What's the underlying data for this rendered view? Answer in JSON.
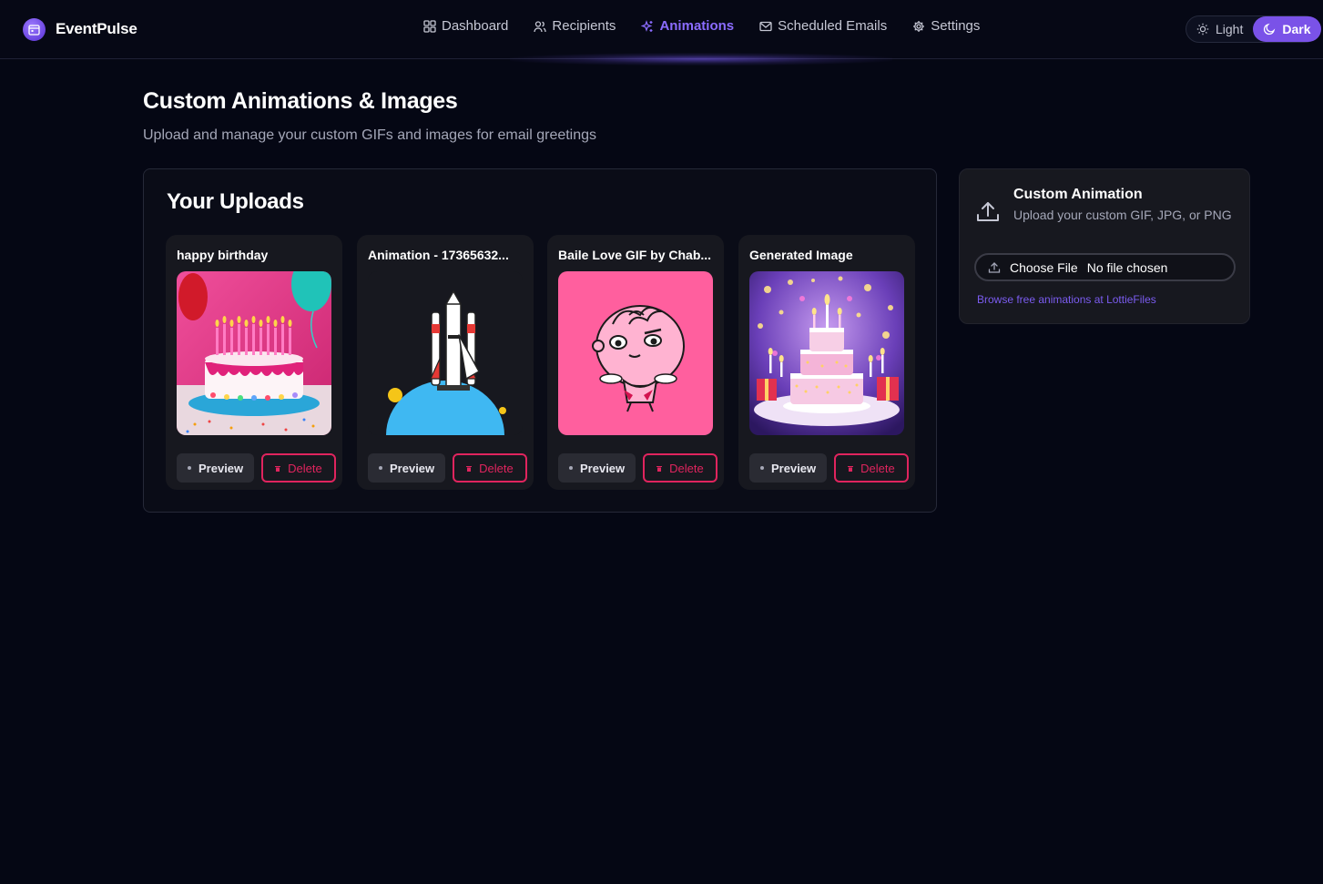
{
  "app": {
    "name": "EventPulse"
  },
  "nav": {
    "items": [
      {
        "label": "Dashboard",
        "icon": "grid-icon"
      },
      {
        "label": "Recipients",
        "icon": "users-icon"
      },
      {
        "label": "Animations",
        "icon": "sparkles-icon",
        "active": true
      },
      {
        "label": "Scheduled Emails",
        "icon": "mail-icon"
      },
      {
        "label": "Settings",
        "icon": "gear-icon"
      }
    ]
  },
  "theme": {
    "light_label": "Light",
    "dark_label": "Dark",
    "selected": "Dark"
  },
  "page": {
    "title": "Custom Animations & Images",
    "subtitle": "Upload and manage your custom GIFs and images for email greetings"
  },
  "uploads": {
    "title": "Your Uploads",
    "items": [
      {
        "title": "happy birthday",
        "thumbnail": "birthday-cake-photo"
      },
      {
        "title": "Animation - 17365632...",
        "thumbnail": "rocket-launch-illustration"
      },
      {
        "title": "Baile Love GIF by Chab...",
        "thumbnail": "pink-cartoon-character"
      },
      {
        "title": "Generated Image",
        "thumbnail": "tiered-cake-sparkles"
      }
    ],
    "preview_label": "Preview",
    "delete_label": "Delete"
  },
  "upload_panel": {
    "title": "Custom Animation",
    "description": "Upload your custom GIF, JPG, or PNG",
    "choose_file_label": "Choose File",
    "file_status": "No file chosen",
    "link_text": "Browse free animations at LottieFiles"
  },
  "colors": {
    "accent": "#7a52e8",
    "active_nav": "#8b6cff",
    "danger": "#e0245e",
    "background": "#050714",
    "card": "#17181f"
  }
}
